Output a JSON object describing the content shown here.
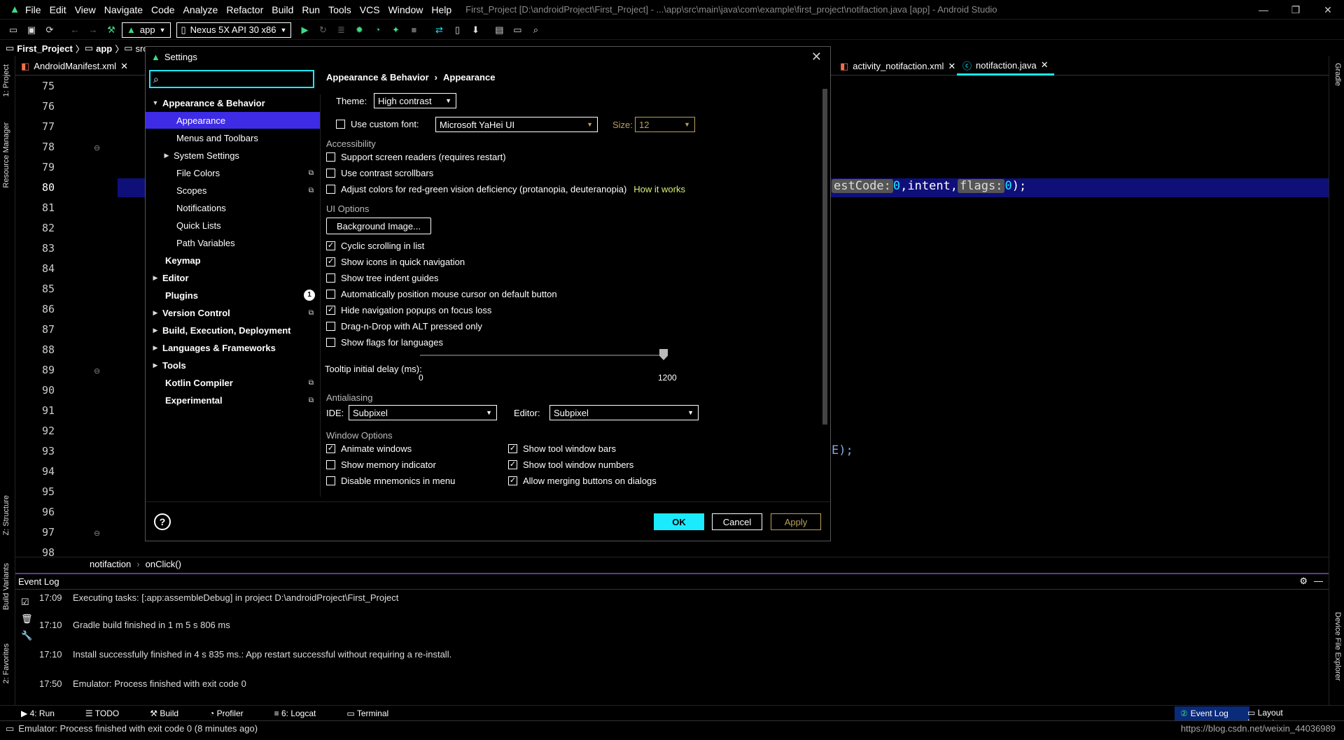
{
  "titlebar": {
    "menu": [
      "File",
      "Edit",
      "View",
      "Navigate",
      "Code",
      "Analyze",
      "Refactor",
      "Build",
      "Run",
      "Tools",
      "VCS",
      "Window",
      "Help"
    ],
    "window_title": "First_Project [D:\\androidProject\\First_Project] - ...\\app\\src\\main\\java\\com\\example\\first_project\\notifaction.java [app] - Android Studio"
  },
  "toolbar": {
    "module_combo": "app",
    "device_combo": "Nexus 5X API 30 x86"
  },
  "navbar": {
    "project": "First_Project",
    "module": "app",
    "src": "src"
  },
  "leftstrip": {
    "project": "1: Project",
    "resource_manager": "Resource Manager",
    "structure": "Z: Structure",
    "build_variants": "Build Variants",
    "favorites": "2: Favorites"
  },
  "rightstrip": {
    "gradle": "Gradle",
    "device_explorer": "Device File Explorer"
  },
  "tabs": {
    "manifest": "AndroidManifest.xml",
    "activity_xml": "activity_notifaction.xml",
    "java": "notifaction.java"
  },
  "editor": {
    "line_numbers": [
      "75",
      "76",
      "77",
      "78",
      "79",
      "80",
      "81",
      "82",
      "83",
      "84",
      "85",
      "86",
      "87",
      "88",
      "89",
      "90",
      "91",
      "92",
      "93",
      "94",
      "95",
      "96",
      "97",
      "98"
    ],
    "line80": {
      "hint1": "estCode:",
      "zero1": "0",
      "mid": ",intent,",
      "hint2": "flags:",
      "zero2": "0",
      "end": ");"
    },
    "line93": "E);",
    "breadcrumb_class": "notifaction",
    "breadcrumb_method": "onClick()"
  },
  "eventlog": {
    "title": "Event Log",
    "entries": [
      {
        "time": "17:09",
        "msg": "Executing tasks: [:app:assembleDebug] in project D:\\androidProject\\First_Project"
      },
      {
        "time": "17:10",
        "msg": "Gradle build finished in 1 m 5 s 806 ms"
      },
      {
        "time": "17:10",
        "msg": "Install successfully finished in 4 s 835 ms.: App restart successful without requiring a re-install."
      },
      {
        "time": "17:50",
        "msg": "Emulator: Process finished with exit code 0"
      }
    ]
  },
  "bottombar": {
    "run": "4: Run",
    "todo": "TODO",
    "build": "Build",
    "profiler": "Profiler",
    "logcat": "6: Logcat",
    "terminal": "Terminal",
    "event_log": "Event Log",
    "layout_inspector": "Layout Inspector"
  },
  "statusbar": {
    "message": "Emulator: Process finished with exit code 0 (8 minutes ago)",
    "right": "https://blog.csdn.net/weixin_44036989"
  },
  "dialog": {
    "title": "Settings",
    "search_placeholder": "",
    "breadcrumb_parent": "Appearance & Behavior",
    "breadcrumb_sep": "›",
    "breadcrumb_current": "Appearance",
    "tree": [
      {
        "label": "Appearance & Behavior",
        "bold": true,
        "expanded": true
      },
      {
        "label": "Appearance",
        "selected": true
      },
      {
        "label": "Menus and Toolbars"
      },
      {
        "label": "System Settings"
      },
      {
        "label": "File Colors"
      },
      {
        "label": "Scopes"
      },
      {
        "label": "Notifications"
      },
      {
        "label": "Quick Lists"
      },
      {
        "label": "Path Variables"
      },
      {
        "label": "Keymap"
      },
      {
        "label": "Editor"
      },
      {
        "label": "Plugins",
        "badge": "1"
      },
      {
        "label": "Version Control"
      },
      {
        "label": "Build, Execution, Deployment"
      },
      {
        "label": "Languages & Frameworks"
      },
      {
        "label": "Tools"
      },
      {
        "label": "Kotlin Compiler"
      },
      {
        "label": "Experimental"
      }
    ],
    "theme_label": "Theme:",
    "theme_value": "High contrast",
    "custom_font_label": "Use custom font:",
    "custom_font_checked": false,
    "font_value": "Microsoft YaHei UI",
    "size_label": "Size:",
    "size_value": "12",
    "accessibility_header": "Accessibility",
    "screen_readers": "Support screen readers (requires restart)",
    "contrast_scrollbars": "Use contrast scrollbars",
    "adjust_colors": "Adjust colors for red-green vision deficiency (protanopia, deuteranopia)",
    "how_it_works": "How it works",
    "ui_options_header": "UI Options",
    "background_image": "Background Image...",
    "cyclic_scrolling": "Cyclic scrolling in list",
    "show_icons": "Show icons in quick navigation",
    "tree_indent": "Show tree indent guides",
    "auto_position": "Automatically position mouse cursor on default button",
    "hide_popups": "Hide navigation popups on focus loss",
    "drag_drop": "Drag-n-Drop with ALT pressed only",
    "show_flags": "Show flags for languages",
    "tooltip_label": "Tooltip initial delay (ms):",
    "tooltip_min": "0",
    "tooltip_max": "1200",
    "tooltip_value": 1200,
    "antialiasing_header": "Antialiasing",
    "ide_label": "IDE:",
    "ide_value": "Subpixel",
    "editor_label": "Editor:",
    "editor_value": "Subpixel",
    "window_options_header": "Window Options",
    "animate_windows": "Animate windows",
    "memory_indicator": "Show memory indicator",
    "disable_mnemonics": "Disable mnemonics in menu",
    "tool_window_bars": "Show tool window bars",
    "tool_window_numbers": "Show tool window numbers",
    "merging_buttons": "Allow merging buttons on dialogs",
    "help": "?",
    "ok": "OK",
    "cancel": "Cancel",
    "apply": "Apply"
  },
  "colors": {
    "accent": "#1aebff",
    "selection": "#3e2be6",
    "current_line": "#0f0f7a",
    "link": "#d7f07a",
    "disabled": "#b9a15a"
  }
}
